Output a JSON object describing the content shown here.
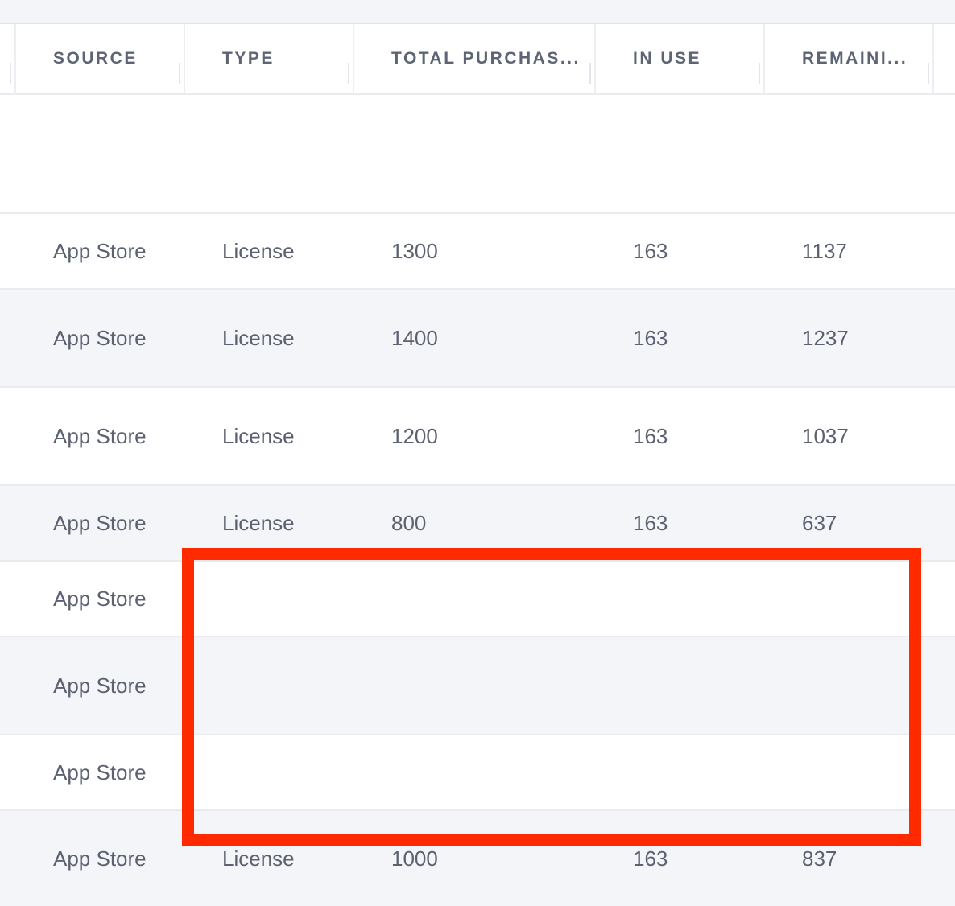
{
  "table": {
    "columns": [
      {
        "key": "source",
        "label": "SOURCE"
      },
      {
        "key": "type",
        "label": "TYPE"
      },
      {
        "key": "total",
        "label": "TOTAL PURCHAS..."
      },
      {
        "key": "in_use",
        "label": "IN USE"
      },
      {
        "key": "remaining",
        "label": "REMAINI..."
      }
    ],
    "rows": [
      {
        "source": "App Store",
        "type": "License",
        "total": "1300",
        "in_use": "163",
        "remaining": "1137"
      },
      {
        "source": "App Store",
        "type": "License",
        "total": "1400",
        "in_use": "163",
        "remaining": "1237"
      },
      {
        "source": "App Store",
        "type": "License",
        "total": "1200",
        "in_use": "163",
        "remaining": "1037"
      },
      {
        "source": "App Store",
        "type": "License",
        "total": "800",
        "in_use": "163",
        "remaining": "637"
      },
      {
        "source": "App Store",
        "type": "",
        "total": "",
        "in_use": "",
        "remaining": ""
      },
      {
        "source": "App Store",
        "type": "",
        "total": "",
        "in_use": "",
        "remaining": ""
      },
      {
        "source": "App Store",
        "type": "",
        "total": "",
        "in_use": "",
        "remaining": ""
      },
      {
        "source": "App Store",
        "type": "License",
        "total": "1000",
        "in_use": "163",
        "remaining": "837"
      }
    ]
  },
  "colors": {
    "highlight": "#ff2a00",
    "header_text": "#5d6575",
    "cell_text": "#5b6170",
    "row_alt": "#f4f5f9"
  }
}
